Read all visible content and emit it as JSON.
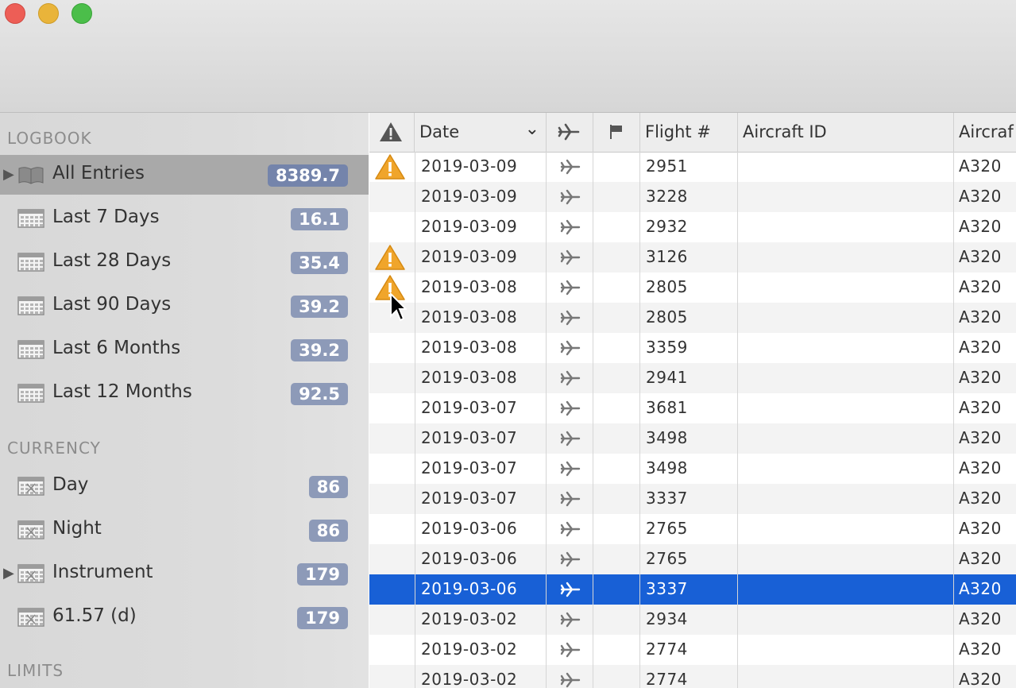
{
  "sidebar": {
    "sections": [
      {
        "header": "LOGBOOK",
        "items": [
          {
            "label": "All Entries",
            "badge": "8389.7",
            "selected": true,
            "disclosure": "▶",
            "icon": "book-icon"
          },
          {
            "label": "Last 7 Days",
            "badge": "16.1",
            "icon": "calendar-icon"
          },
          {
            "label": "Last 28 Days",
            "badge": "35.4",
            "icon": "calendar-icon"
          },
          {
            "label": "Last 90 Days",
            "badge": "39.2",
            "icon": "calendar-icon"
          },
          {
            "label": "Last 6 Months",
            "badge": "39.2",
            "icon": "calendar-icon"
          },
          {
            "label": "Last 12 Months",
            "badge": "92.5",
            "icon": "calendar-icon"
          }
        ]
      },
      {
        "header": "CURRENCY",
        "items": [
          {
            "label": "Day",
            "badge": "86",
            "icon": "currency-calendar-icon"
          },
          {
            "label": "Night",
            "badge": "86",
            "icon": "currency-calendar-icon"
          },
          {
            "label": "Instrument",
            "badge": "179",
            "disclosure": "▶",
            "icon": "currency-calendar-icon"
          },
          {
            "label": "61.57 (d)",
            "badge": "179",
            "icon": "currency-calendar-icon"
          }
        ]
      },
      {
        "header": "LIMITS",
        "items": []
      }
    ]
  },
  "table": {
    "columns": {
      "warning": "warning-icon",
      "date": "Date",
      "date_sort": "⌄",
      "type": "airplane-icon",
      "flag": "flag-icon",
      "flight": "Flight #",
      "aircraft_id": "Aircraft ID",
      "aircraft_type": "Aircraf"
    },
    "rows": [
      {
        "warning": true,
        "date": "2019-03-09",
        "flight": "2951",
        "aircraft_id": "",
        "aircraft_type": "A320"
      },
      {
        "warning": false,
        "date": "2019-03-09",
        "flight": "3228",
        "aircraft_id": "",
        "aircraft_type": "A320"
      },
      {
        "warning": false,
        "date": "2019-03-09",
        "flight": "2932",
        "aircraft_id": "",
        "aircraft_type": "A320"
      },
      {
        "warning": true,
        "date": "2019-03-09",
        "flight": "3126",
        "aircraft_id": "",
        "aircraft_type": "A320"
      },
      {
        "warning": true,
        "date": "2019-03-08",
        "flight": "2805",
        "aircraft_id": "",
        "aircraft_type": "A320"
      },
      {
        "warning": false,
        "date": "2019-03-08",
        "flight": "2805",
        "aircraft_id": "",
        "aircraft_type": "A320"
      },
      {
        "warning": false,
        "date": "2019-03-08",
        "flight": "3359",
        "aircraft_id": "",
        "aircraft_type": "A320"
      },
      {
        "warning": false,
        "date": "2019-03-08",
        "flight": "2941",
        "aircraft_id": "",
        "aircraft_type": "A320"
      },
      {
        "warning": false,
        "date": "2019-03-07",
        "flight": "3681",
        "aircraft_id": "",
        "aircraft_type": "A320"
      },
      {
        "warning": false,
        "date": "2019-03-07",
        "flight": "3498",
        "aircraft_id": "",
        "aircraft_type": "A320"
      },
      {
        "warning": false,
        "date": "2019-03-07",
        "flight": "3498",
        "aircraft_id": "",
        "aircraft_type": "A320"
      },
      {
        "warning": false,
        "date": "2019-03-07",
        "flight": "3337",
        "aircraft_id": "",
        "aircraft_type": "A320"
      },
      {
        "warning": false,
        "date": "2019-03-06",
        "flight": "2765",
        "aircraft_id": "",
        "aircraft_type": "A320"
      },
      {
        "warning": false,
        "date": "2019-03-06",
        "flight": "2765",
        "aircraft_id": "",
        "aircraft_type": "A320"
      },
      {
        "warning": false,
        "date": "2019-03-06",
        "flight": "3337",
        "aircraft_id": "",
        "aircraft_type": "A320",
        "selected": true
      },
      {
        "warning": false,
        "date": "2019-03-02",
        "flight": "2934",
        "aircraft_id": "",
        "aircraft_type": "A320"
      },
      {
        "warning": false,
        "date": "2019-03-02",
        "flight": "2774",
        "aircraft_id": "",
        "aircraft_type": "A320"
      },
      {
        "warning": false,
        "date": "2019-03-02",
        "flight": "2774",
        "aircraft_id": "",
        "aircraft_type": "A320"
      }
    ]
  },
  "colors": {
    "selection": "#1860d6",
    "badge": "#8d9ab8",
    "warning": "#f0a52b"
  }
}
